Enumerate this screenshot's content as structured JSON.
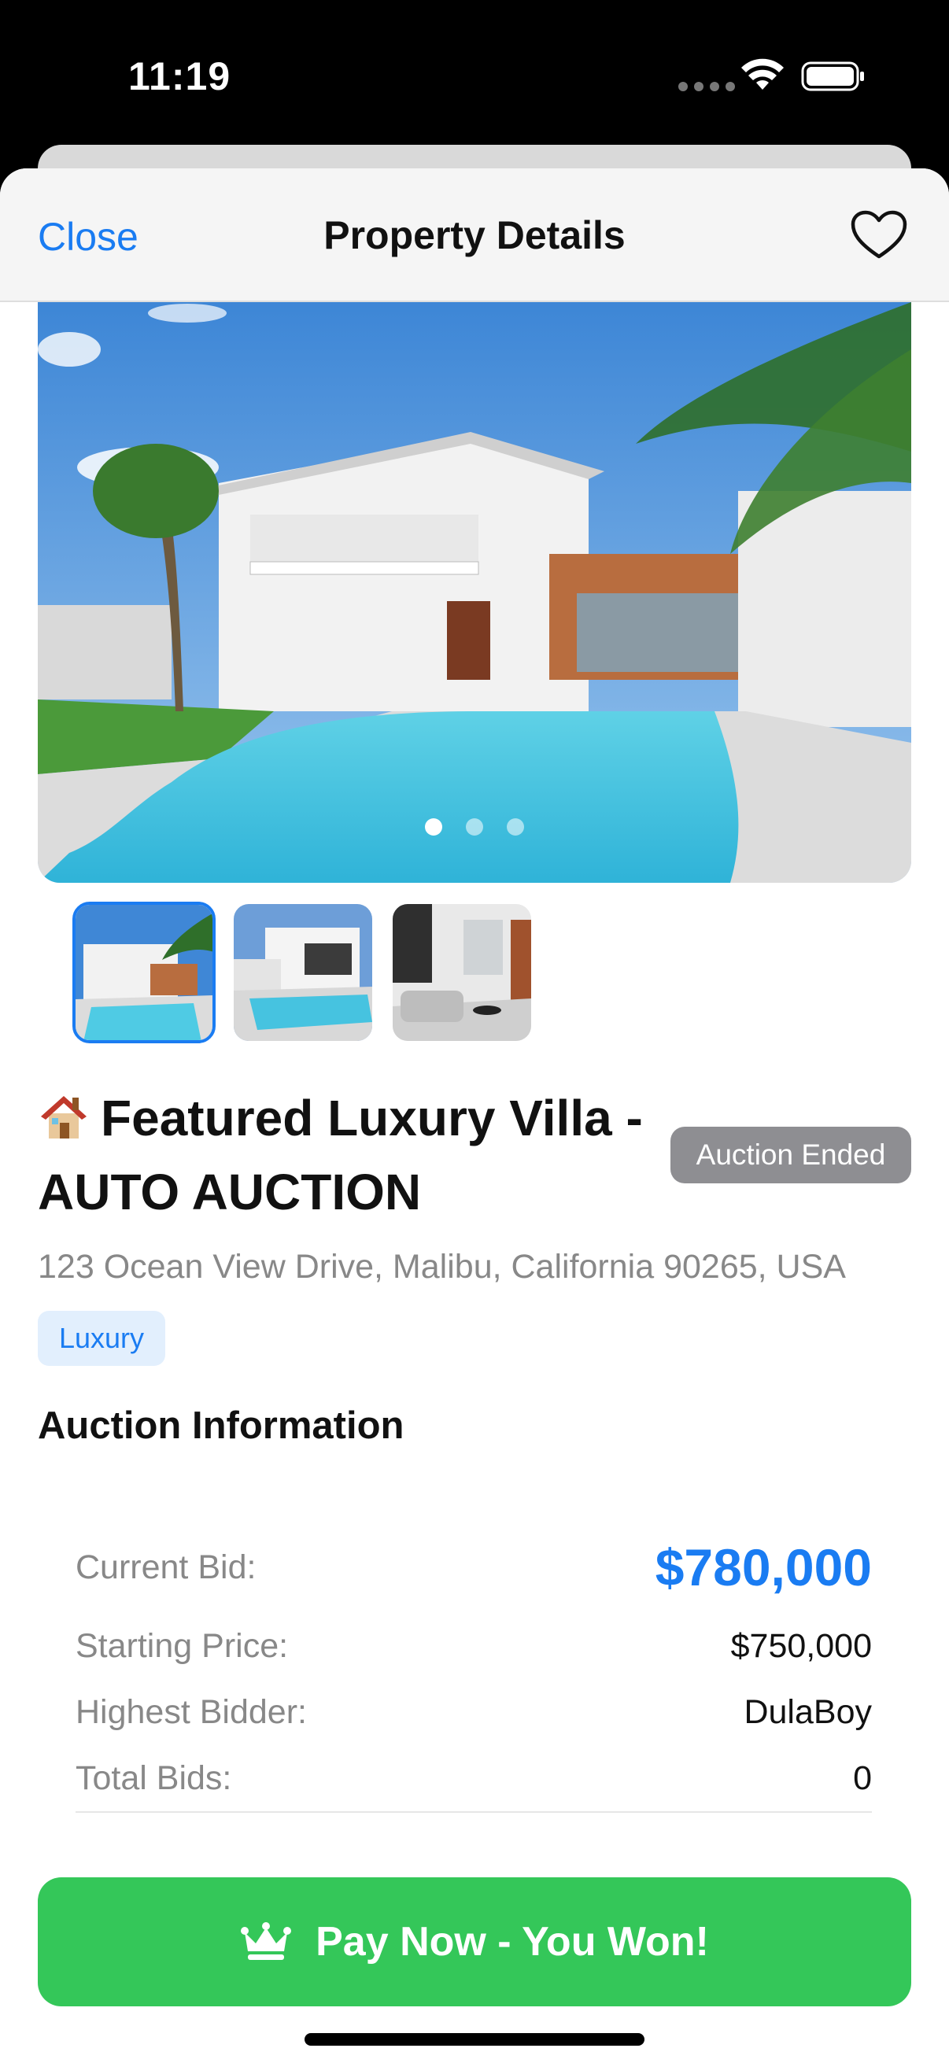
{
  "status_bar": {
    "time": "11:19"
  },
  "nav": {
    "close_label": "Close",
    "title": "Property Details"
  },
  "gallery": {
    "pages": 3,
    "current_page": 1,
    "thumbnails": [
      "villa-pool",
      "modern-house-pool",
      "living-room"
    ],
    "selected_thumbnail": 1
  },
  "property": {
    "emoji": "house-emoji",
    "title": "Featured Luxury Villa - AUTO AUCTION",
    "status_badge": "Auction Ended",
    "address": "123 Ocean View Drive, Malibu, California 90265, USA",
    "tag": "Luxury"
  },
  "auction": {
    "section_title": "Auction Information",
    "current_bid_label": "Current Bid:",
    "current_bid_value": "$780,000",
    "starting_price_label": "Starting Price:",
    "starting_price_value": "$750,000",
    "highest_bidder_label": "Highest Bidder:",
    "highest_bidder_value": "DulaBoy",
    "total_bids_label": "Total Bids:",
    "total_bids_value": "0"
  },
  "actions": {
    "pay_label": "Pay Now - You Won!"
  },
  "colors": {
    "accent": "#1a7cf2",
    "success": "#34c759",
    "badge": "#8e8e92"
  }
}
